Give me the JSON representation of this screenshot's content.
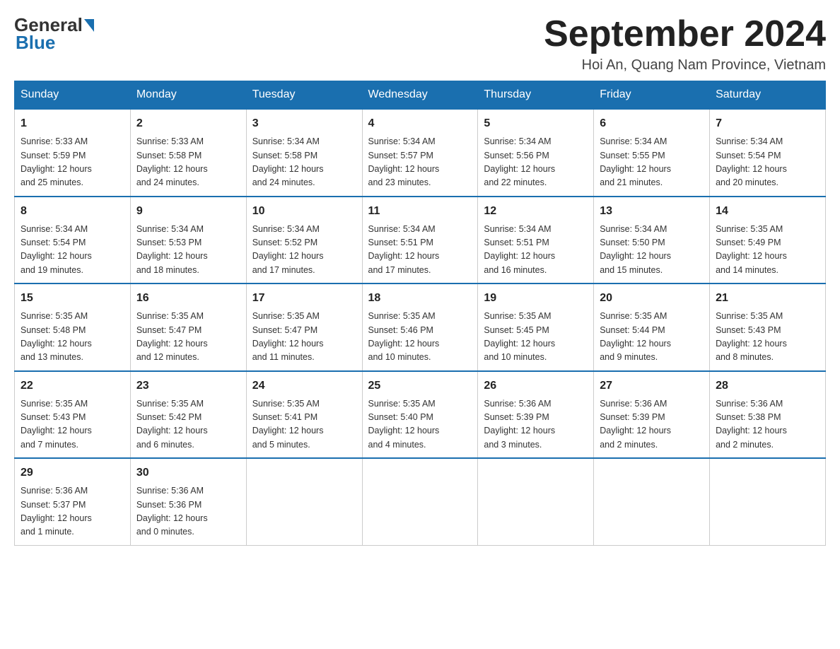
{
  "header": {
    "logo_general": "General",
    "logo_blue": "Blue",
    "month_year": "September 2024",
    "location": "Hoi An, Quang Nam Province, Vietnam"
  },
  "days_of_week": [
    "Sunday",
    "Monday",
    "Tuesday",
    "Wednesday",
    "Thursday",
    "Friday",
    "Saturday"
  ],
  "weeks": [
    [
      {
        "day": "1",
        "info": "Sunrise: 5:33 AM\nSunset: 5:59 PM\nDaylight: 12 hours\nand 25 minutes."
      },
      {
        "day": "2",
        "info": "Sunrise: 5:33 AM\nSunset: 5:58 PM\nDaylight: 12 hours\nand 24 minutes."
      },
      {
        "day": "3",
        "info": "Sunrise: 5:34 AM\nSunset: 5:58 PM\nDaylight: 12 hours\nand 24 minutes."
      },
      {
        "day": "4",
        "info": "Sunrise: 5:34 AM\nSunset: 5:57 PM\nDaylight: 12 hours\nand 23 minutes."
      },
      {
        "day": "5",
        "info": "Sunrise: 5:34 AM\nSunset: 5:56 PM\nDaylight: 12 hours\nand 22 minutes."
      },
      {
        "day": "6",
        "info": "Sunrise: 5:34 AM\nSunset: 5:55 PM\nDaylight: 12 hours\nand 21 minutes."
      },
      {
        "day": "7",
        "info": "Sunrise: 5:34 AM\nSunset: 5:54 PM\nDaylight: 12 hours\nand 20 minutes."
      }
    ],
    [
      {
        "day": "8",
        "info": "Sunrise: 5:34 AM\nSunset: 5:54 PM\nDaylight: 12 hours\nand 19 minutes."
      },
      {
        "day": "9",
        "info": "Sunrise: 5:34 AM\nSunset: 5:53 PM\nDaylight: 12 hours\nand 18 minutes."
      },
      {
        "day": "10",
        "info": "Sunrise: 5:34 AM\nSunset: 5:52 PM\nDaylight: 12 hours\nand 17 minutes."
      },
      {
        "day": "11",
        "info": "Sunrise: 5:34 AM\nSunset: 5:51 PM\nDaylight: 12 hours\nand 17 minutes."
      },
      {
        "day": "12",
        "info": "Sunrise: 5:34 AM\nSunset: 5:51 PM\nDaylight: 12 hours\nand 16 minutes."
      },
      {
        "day": "13",
        "info": "Sunrise: 5:34 AM\nSunset: 5:50 PM\nDaylight: 12 hours\nand 15 minutes."
      },
      {
        "day": "14",
        "info": "Sunrise: 5:35 AM\nSunset: 5:49 PM\nDaylight: 12 hours\nand 14 minutes."
      }
    ],
    [
      {
        "day": "15",
        "info": "Sunrise: 5:35 AM\nSunset: 5:48 PM\nDaylight: 12 hours\nand 13 minutes."
      },
      {
        "day": "16",
        "info": "Sunrise: 5:35 AM\nSunset: 5:47 PM\nDaylight: 12 hours\nand 12 minutes."
      },
      {
        "day": "17",
        "info": "Sunrise: 5:35 AM\nSunset: 5:47 PM\nDaylight: 12 hours\nand 11 minutes."
      },
      {
        "day": "18",
        "info": "Sunrise: 5:35 AM\nSunset: 5:46 PM\nDaylight: 12 hours\nand 10 minutes."
      },
      {
        "day": "19",
        "info": "Sunrise: 5:35 AM\nSunset: 5:45 PM\nDaylight: 12 hours\nand 10 minutes."
      },
      {
        "day": "20",
        "info": "Sunrise: 5:35 AM\nSunset: 5:44 PM\nDaylight: 12 hours\nand 9 minutes."
      },
      {
        "day": "21",
        "info": "Sunrise: 5:35 AM\nSunset: 5:43 PM\nDaylight: 12 hours\nand 8 minutes."
      }
    ],
    [
      {
        "day": "22",
        "info": "Sunrise: 5:35 AM\nSunset: 5:43 PM\nDaylight: 12 hours\nand 7 minutes."
      },
      {
        "day": "23",
        "info": "Sunrise: 5:35 AM\nSunset: 5:42 PM\nDaylight: 12 hours\nand 6 minutes."
      },
      {
        "day": "24",
        "info": "Sunrise: 5:35 AM\nSunset: 5:41 PM\nDaylight: 12 hours\nand 5 minutes."
      },
      {
        "day": "25",
        "info": "Sunrise: 5:35 AM\nSunset: 5:40 PM\nDaylight: 12 hours\nand 4 minutes."
      },
      {
        "day": "26",
        "info": "Sunrise: 5:36 AM\nSunset: 5:39 PM\nDaylight: 12 hours\nand 3 minutes."
      },
      {
        "day": "27",
        "info": "Sunrise: 5:36 AM\nSunset: 5:39 PM\nDaylight: 12 hours\nand 2 minutes."
      },
      {
        "day": "28",
        "info": "Sunrise: 5:36 AM\nSunset: 5:38 PM\nDaylight: 12 hours\nand 2 minutes."
      }
    ],
    [
      {
        "day": "29",
        "info": "Sunrise: 5:36 AM\nSunset: 5:37 PM\nDaylight: 12 hours\nand 1 minute."
      },
      {
        "day": "30",
        "info": "Sunrise: 5:36 AM\nSunset: 5:36 PM\nDaylight: 12 hours\nand 0 minutes."
      },
      null,
      null,
      null,
      null,
      null
    ]
  ]
}
